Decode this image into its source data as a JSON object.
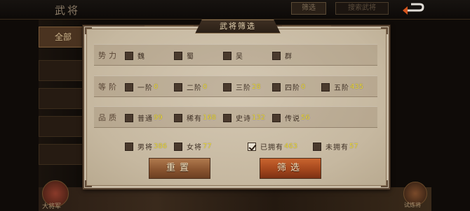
{
  "background": {
    "title": "武将",
    "filter_label": "筛选",
    "search_placeholder": "搜索武将",
    "left_nav": [
      "全部",
      "",
      "",
      "",
      ""
    ],
    "bottom_left_label": "大将军",
    "bottom_right_label": "试炼将"
  },
  "dialog": {
    "title": "武将筛选",
    "faction": {
      "label": "势力",
      "options": [
        {
          "label": "魏",
          "checked": false
        },
        {
          "label": "蜀",
          "checked": false
        },
        {
          "label": "吴",
          "checked": false
        },
        {
          "label": "群",
          "checked": false
        }
      ]
    },
    "tier": {
      "label": "等阶",
      "options": [
        {
          "label": "一阶",
          "count": "0",
          "checked": false
        },
        {
          "label": "二阶",
          "count": "0",
          "checked": false
        },
        {
          "label": "三阶",
          "count": "28",
          "checked": false
        },
        {
          "label": "四阶",
          "count": "0",
          "checked": false
        },
        {
          "label": "五阶",
          "count": "435",
          "checked": false
        }
      ]
    },
    "quality": {
      "label": "品质",
      "options": [
        {
          "label": "普通",
          "count": "99",
          "checked": false
        },
        {
          "label": "稀有",
          "count": "168",
          "checked": false
        },
        {
          "label": "史诗",
          "count": "132",
          "checked": false
        },
        {
          "label": "传说",
          "count": "56",
          "checked": false
        }
      ]
    },
    "extra": {
      "options": [
        {
          "label": "男将",
          "count": "386",
          "checked": false
        },
        {
          "label": "女将",
          "count": "77",
          "checked": false
        },
        {
          "label": "已拥有",
          "count": "463",
          "checked": true
        },
        {
          "label": "未拥有",
          "count": "57",
          "checked": false
        }
      ]
    },
    "reset_label": "重置",
    "confirm_label": "筛选"
  },
  "colors": {
    "panel": "#c9bca6",
    "count_yellow": "#f0dc3c",
    "reset_button": "#8a5530",
    "confirm_button": "#a4471d"
  }
}
